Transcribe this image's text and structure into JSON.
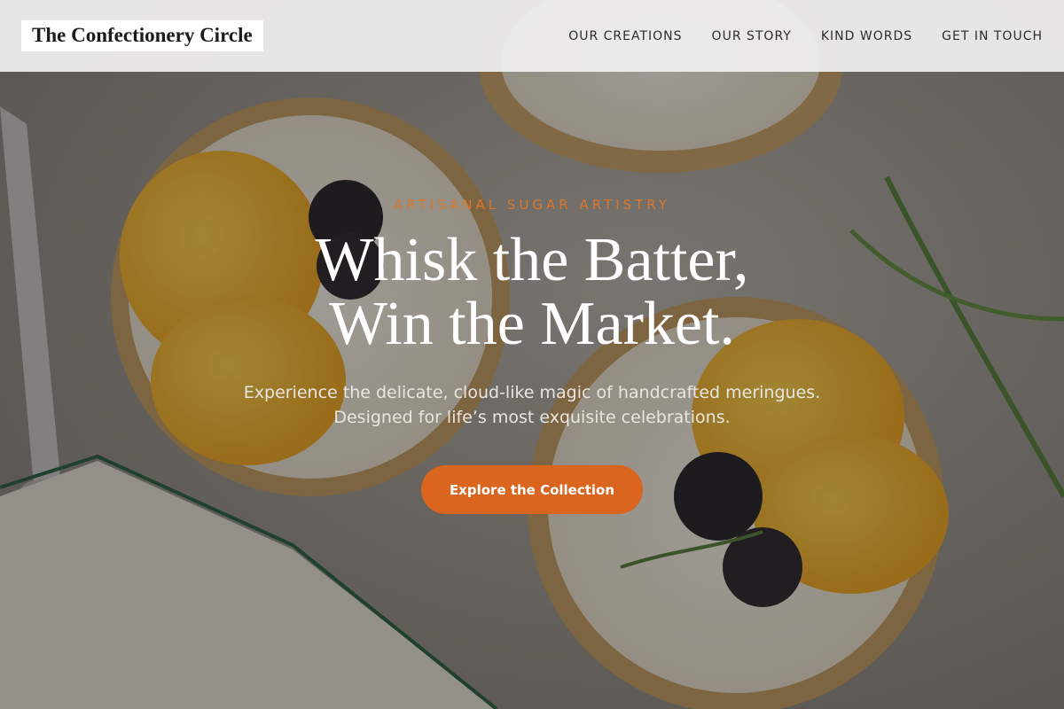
{
  "header": {
    "logo": "The Confectionery Circle",
    "nav": [
      {
        "label": "OUR CREATIONS"
      },
      {
        "label": "OUR STORY"
      },
      {
        "label": "KIND WORDS"
      },
      {
        "label": "GET IN TOUCH"
      }
    ]
  },
  "hero": {
    "eyebrow": "ARTISANAL SUGAR ARTISTRY",
    "headline_line1": "Whisk the Batter,",
    "headline_line2": "Win the Market.",
    "subtitle_line1": "Experience the delicate, cloud-like magic of handcrafted meringues.",
    "subtitle_line2": "Designed for life’s most exquisite celebrations.",
    "cta_label": "Explore the Collection",
    "background_image": "tarts-with-orange-slices-and-blackberries"
  },
  "colors": {
    "accent": "#d9651f",
    "eyebrow": "#d9772e",
    "header_bg": "#f0f0ef"
  }
}
